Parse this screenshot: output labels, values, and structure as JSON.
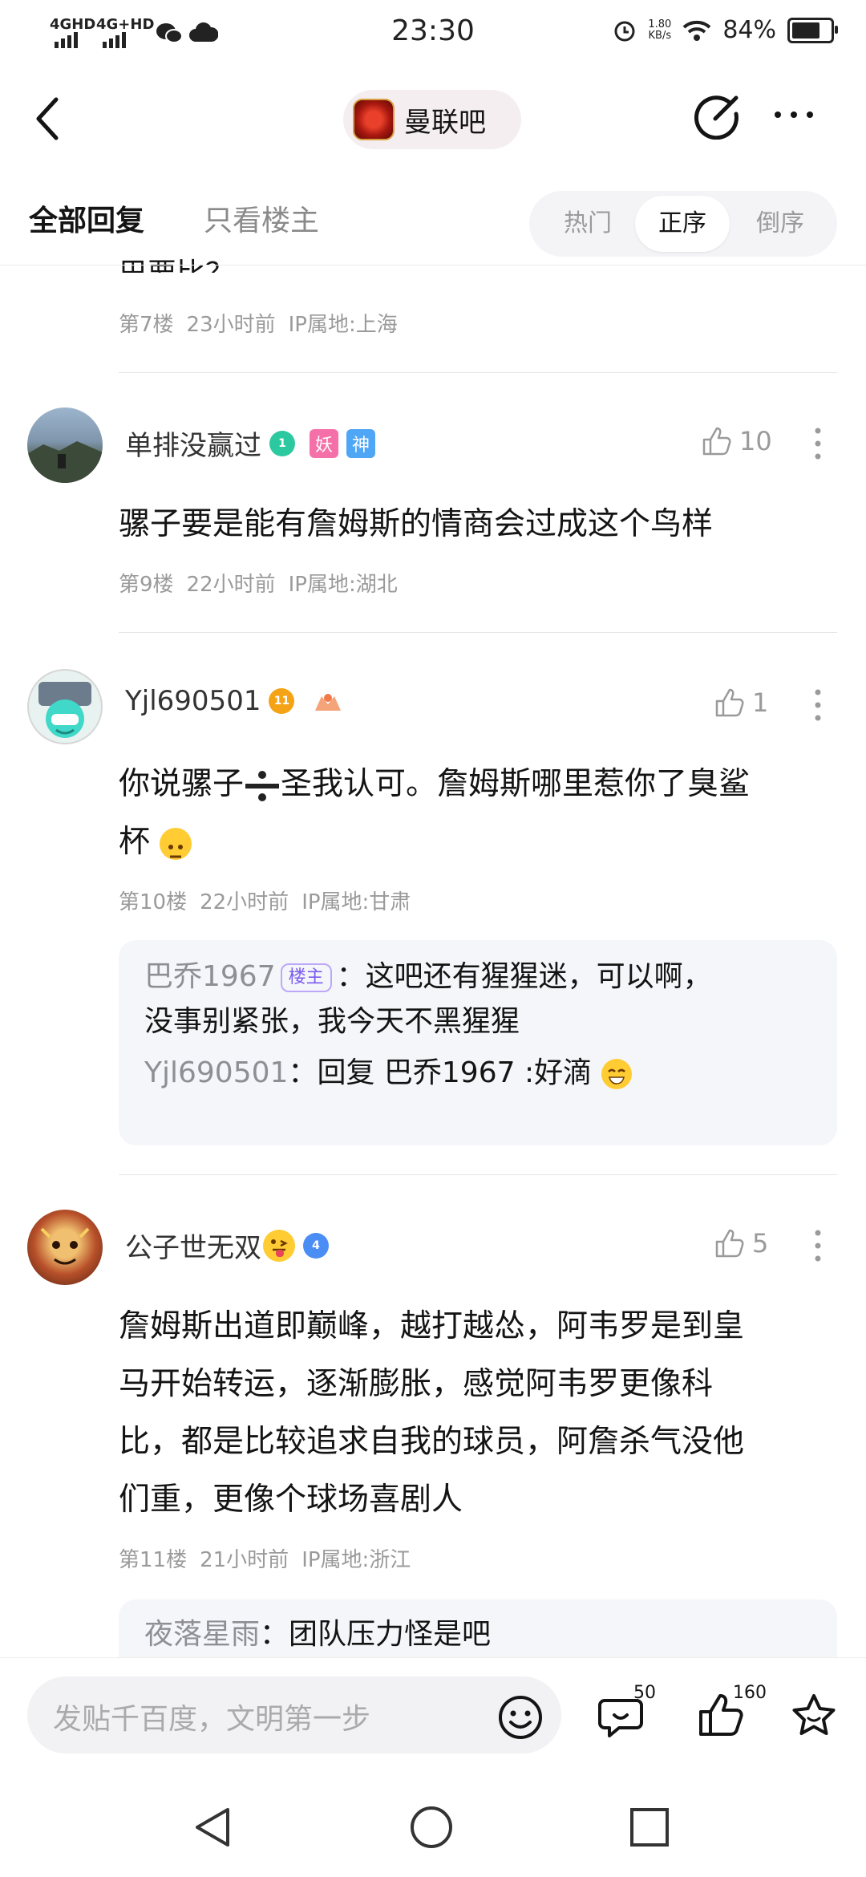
{
  "status_bar": {
    "network1": "4GHD",
    "network2": "4G+HD",
    "time": "23:30",
    "speed_value": "1.80",
    "speed_unit": "KB/s",
    "battery": "84%",
    "battery_level": 0.84
  },
  "header": {
    "forum_name": "曼联吧",
    "back_icon": "chevron-left-icon",
    "share_icon": "share-edit-icon",
    "more_icon": "more-dots-icon"
  },
  "tabs": {
    "all_replies": "全部回复",
    "only_op": "只看楼主",
    "sort_options": [
      "热门",
      "正序",
      "倒序"
    ],
    "selected_sort": "正序"
  },
  "partial_post": {
    "text": "巴要比？",
    "floor": "第7楼",
    "time": "23小时前",
    "ip": "IP属地:上海"
  },
  "posts": [
    {
      "username": "单排没赢过",
      "level": "1",
      "tags": [
        "妖",
        "神"
      ],
      "likes": "10",
      "content": "骡子要是能有詹姆斯的情商会过成这个鸟样",
      "floor": "第9楼",
      "time": "22小时前",
      "ip": "IP属地:湖北"
    },
    {
      "username": "Yjl690501",
      "level": "11",
      "likes": "1",
      "content_line1": "你说骡子",
      "content_line1b": "圣我认可。詹姆斯哪里惹你了臭鲨",
      "content_line2": "杯",
      "floor": "第10楼",
      "time": "22小时前",
      "ip": "IP属地:甘肃",
      "replies": [
        {
          "name": "巴乔1967",
          "tag": "楼主",
          "sep": "：",
          "text": "这吧还有猩猩迷，可以啊，",
          "text2": "没事别紧张，我今天不黑猩猩"
        },
        {
          "name": "Yjl690501",
          "sep": "：",
          "text": "回复 巴乔1967 :好滴"
        }
      ]
    },
    {
      "username": "公子世无双",
      "level": "4",
      "likes": "5",
      "content_lines": [
        "詹姆斯出道即巅峰，越打越怂，阿韦罗是到皇",
        "马开始转运，逐渐膨胀，感觉阿韦罗更像科",
        "比，都是比较追求自我的球员，阿詹杀气没他",
        "们重，更像个球场喜剧人"
      ],
      "floor": "第11楼",
      "time": "21小时前",
      "ip": "IP属地:浙江",
      "replies": [
        {
          "name": "夜落星雨",
          "sep": "：",
          "text": "团队压力怪是吧"
        }
      ]
    }
  ],
  "bottom_bar": {
    "input_placeholder": "发贴千百度，文明第一步",
    "comment_count": "50",
    "like_count": "160"
  },
  "colors": {
    "accent_purple": "#7b5cf0",
    "gem_green": "#2cc8a0",
    "gem_orange": "#f5a316",
    "gem_blue": "#4a8ef5",
    "tag_pink": "#f56fa8",
    "tag_blue": "#4fa6f5"
  }
}
